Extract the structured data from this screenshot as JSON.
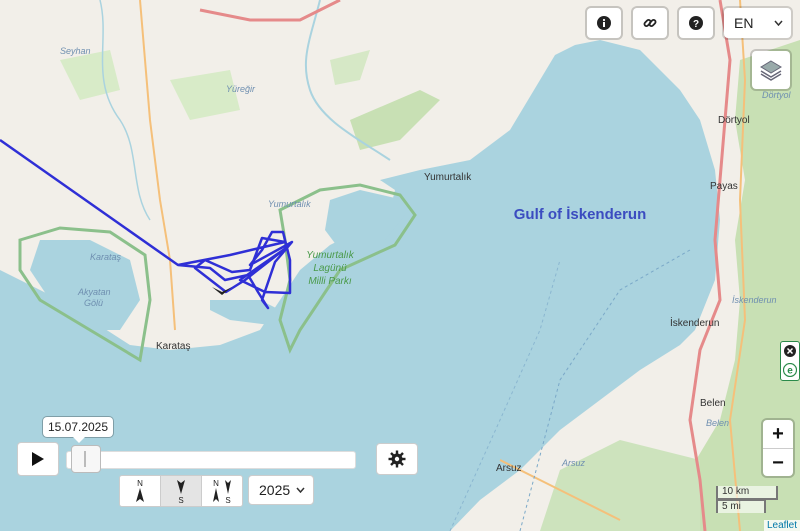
{
  "map": {
    "water_color": "#aad3df",
    "land_color": "#f2efe9",
    "track_color": "#2f2fd6",
    "labels": {
      "gulf": "Gulf of İskenderun",
      "seyhan": "Seyhan",
      "yuregir": "Yüreğir",
      "yumurtalik_town": "Yumurtalık",
      "yumurtalik_small": "Yumurtalık",
      "park_line1": "Yumurtalık",
      "park_line2": "Lagünü",
      "park_line3": "Milli Parkı",
      "karatas_lagoon": "Karataş",
      "akyatan1": "Akyatan",
      "akyatan2": "Gölü",
      "karatas": "Karataş",
      "dortyol": "Dörtyol",
      "dortyol_road": "Dörtyol",
      "payas": "Payas",
      "iskenderun": "İskenderun",
      "iskenderun_road": "İskenderun",
      "belen": "Belen",
      "belen_road": "Belen",
      "arsuz": "Arsuz",
      "arsuz_road": "Arsuz"
    }
  },
  "toolbar": {
    "info_icon": "info-icon",
    "link_icon": "link-icon",
    "help_icon": "help-icon",
    "language": "EN",
    "layers_icon": "layers-icon"
  },
  "zoom": {
    "plus": "+",
    "minus": "−"
  },
  "scale": {
    "km": "10 km",
    "mi": "5 mi"
  },
  "attribution": "Leaflet",
  "timeline": {
    "date": "15.07.2025",
    "progress": 0.02,
    "year": "2025",
    "orientation": [
      {
        "top": "N",
        "bottom": "",
        "selected": false
      },
      {
        "top": "",
        "bottom": "S",
        "selected": true
      },
      {
        "top": "N",
        "bottom": "S",
        "selected": false
      }
    ]
  }
}
